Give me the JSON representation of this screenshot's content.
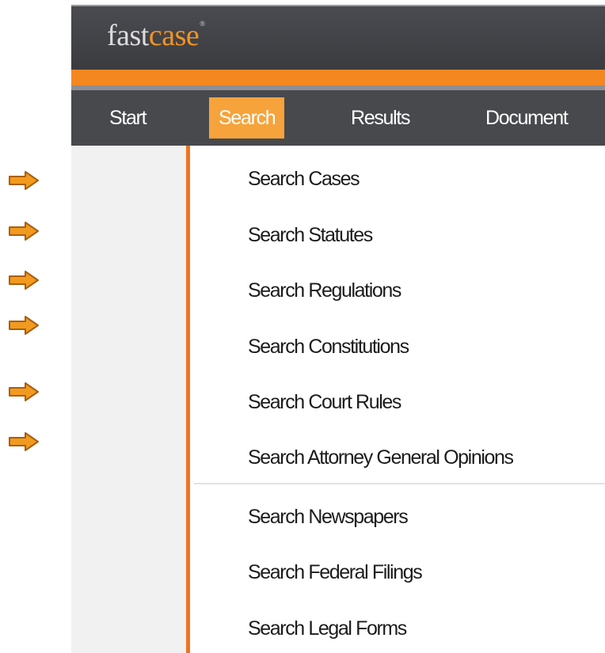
{
  "brand": {
    "name_part1": "fast",
    "name_part2": "case",
    "registered": "®",
    "accent_color": "#f4871f",
    "active_tab_color": "#f6a33b"
  },
  "nav": {
    "tabs": [
      {
        "label": "Start"
      },
      {
        "label": "Search",
        "active": true
      },
      {
        "label": "Results"
      },
      {
        "label": "Document"
      }
    ]
  },
  "search_menu": {
    "primary_items": [
      {
        "label": "Search Cases",
        "marked": true
      },
      {
        "label": "Search Statutes",
        "marked": true
      },
      {
        "label": "Search Regulations",
        "marked": true
      },
      {
        "label": "Search Constitutions",
        "marked": true
      },
      {
        "label": "Search Court Rules",
        "marked": true
      },
      {
        "label": "Search Attorney General Opinions",
        "marked": true
      }
    ],
    "secondary_items": [
      {
        "label": "Search Newspapers"
      },
      {
        "label": "Search Federal Filings"
      },
      {
        "label": "Search Legal Forms"
      }
    ]
  },
  "annotations": {
    "arrow_icon": "right-arrow-icon",
    "arrow_color": "#f29a1f"
  }
}
